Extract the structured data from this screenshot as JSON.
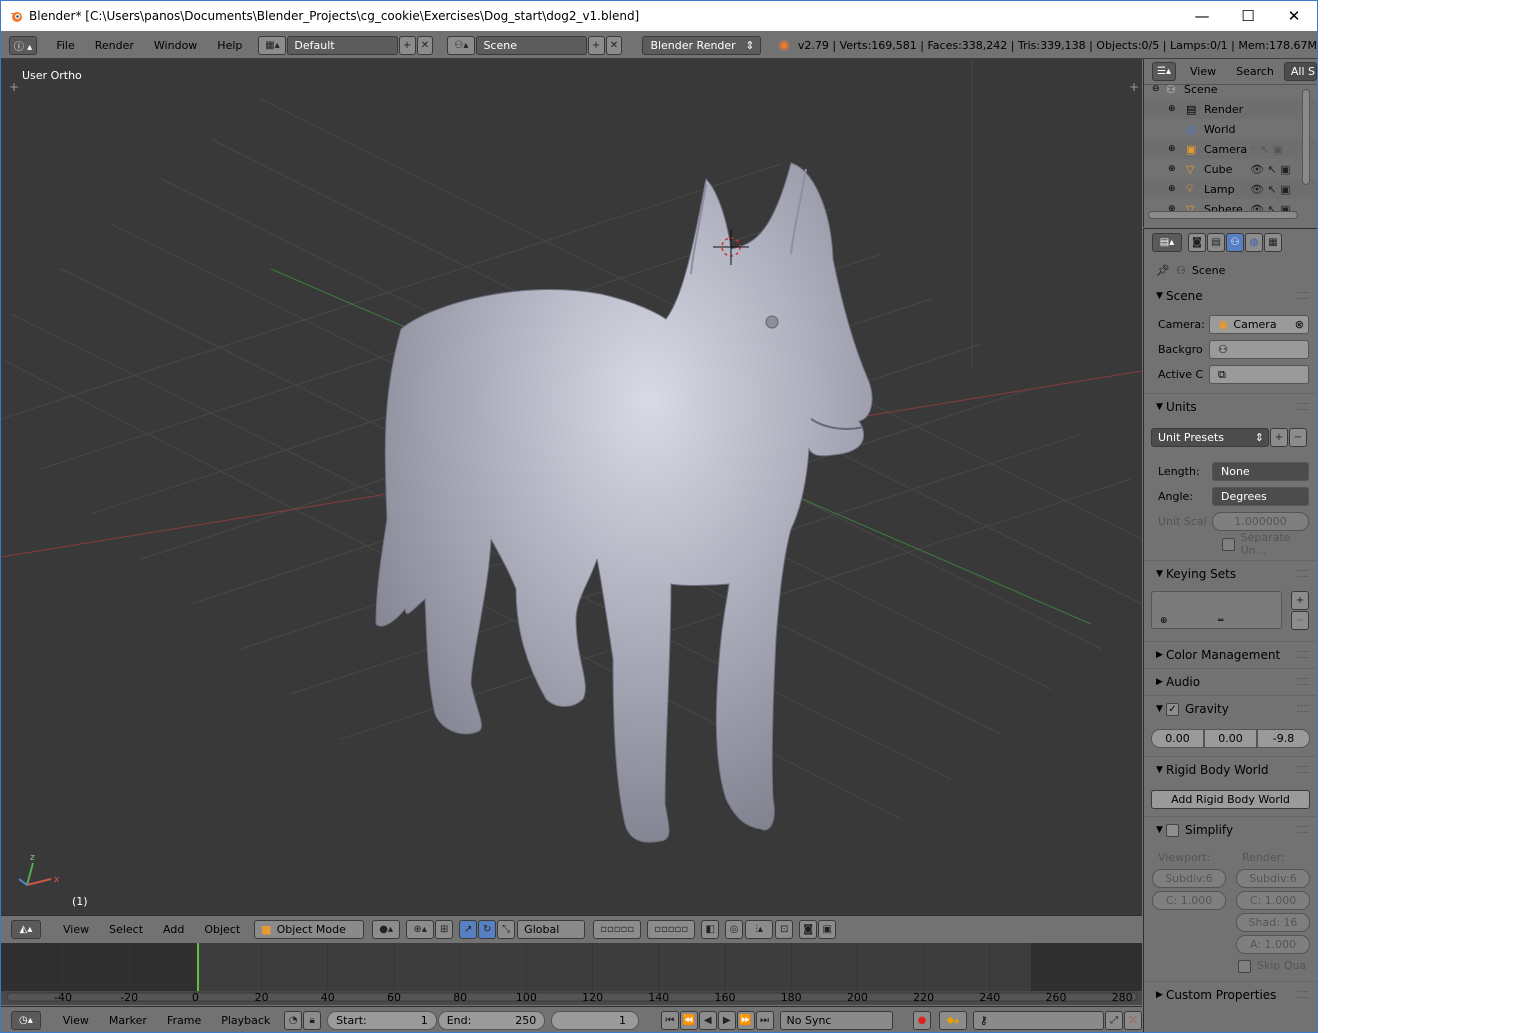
{
  "titlebar": {
    "title": "Blender* [C:\\Users\\panos\\Documents\\Blender_Projects\\cg_cookie\\Exercises\\Dog_start\\dog2_v1.blend]",
    "minimize": "—",
    "maximize": "☐",
    "close": "✕"
  },
  "menubar": {
    "items": [
      "File",
      "Render",
      "Window",
      "Help"
    ],
    "layout": "Default",
    "scene": "Scene",
    "engine": "Blender Render",
    "stats": "v2.79 | Verts:169,581 | Faces:338,242 | Tris:339,138 | Objects:0/5 | Lamps:0/1 | Mem:178.67M"
  },
  "viewport": {
    "view_label": "User Ortho",
    "frame_label": "(1)",
    "axis_x": "x",
    "axis_z": "z"
  },
  "view3d_header": {
    "items": [
      "View",
      "Select",
      "Add",
      "Object"
    ],
    "mode": "Object Mode",
    "orientation": "Global"
  },
  "timeline": {
    "ticks": [
      "-40",
      "-20",
      "0",
      "20",
      "40",
      "60",
      "80",
      "100",
      "120",
      "140",
      "160",
      "180",
      "200",
      "220",
      "240",
      "260",
      "280"
    ],
    "current_frame": 0
  },
  "timeline_header": {
    "items": [
      "View",
      "Marker",
      "Frame",
      "Playback"
    ],
    "start_label": "Start:",
    "start": "1",
    "end_label": "End:",
    "end": "250",
    "frame": "1",
    "sync": "No Sync"
  },
  "outliner": {
    "menu": [
      "View",
      "Search"
    ],
    "filter": "All S",
    "rows": [
      {
        "label": "Scene",
        "icon": "scene-icon"
      },
      {
        "label": "Render",
        "icon": "render-icon"
      },
      {
        "label": "World",
        "icon": "world-icon"
      },
      {
        "label": "Camera",
        "icon": "camera-icon"
      },
      {
        "label": "Cube",
        "icon": "mesh-icon"
      },
      {
        "label": "Lamp",
        "icon": "lamp-icon"
      },
      {
        "label": "Sphere",
        "icon": "mesh-icon"
      }
    ]
  },
  "properties": {
    "context": "Scene",
    "scene_panel": {
      "title": "Scene",
      "camera_label": "Camera:",
      "camera_value": "Camera",
      "background_label": "Backgro",
      "active_clip_label": "Active C"
    },
    "units_panel": {
      "title": "Units",
      "presets": "Unit Presets",
      "length_label": "Length:",
      "length_value": "None",
      "angle_label": "Angle:",
      "angle_value": "Degrees",
      "scale_label": "Unit Scal",
      "scale_value": "1.000000",
      "separate_label": "Separate Un..."
    },
    "keying_panel": {
      "title": "Keying Sets"
    },
    "color_panel": {
      "title": "Color Management"
    },
    "audio_panel": {
      "title": "Audio"
    },
    "gravity_panel": {
      "title": "Gravity",
      "x": "0.00",
      "y": "0.00",
      "z": "-9.8"
    },
    "rigid_panel": {
      "title": "Rigid Body World",
      "button": "Add Rigid Body World"
    },
    "simplify_panel": {
      "title": "Simplify",
      "viewport_label": "Viewport:",
      "render_label": "Render:",
      "v_subdiv": "Subdiv:6",
      "v_c": "C: 1.000",
      "r_subdiv": "Subdiv:6",
      "r_c": "C: 1.000",
      "r_shad": "Shad: 16",
      "r_a": "A: 1.000",
      "skip_label": "Skip Qua"
    },
    "custom_panel": {
      "title": "Custom Properties"
    }
  }
}
